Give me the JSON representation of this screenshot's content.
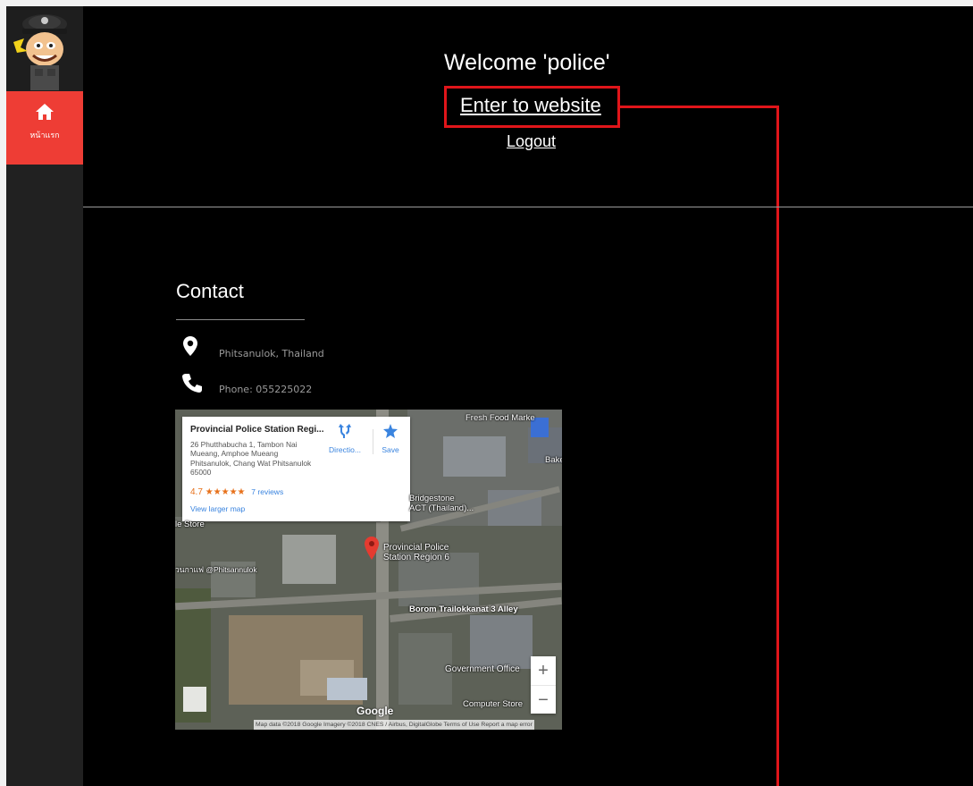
{
  "sidebar": {
    "logo": "police-mascot-logo",
    "home": {
      "icon": "home-icon",
      "label": "หน้าแรก"
    }
  },
  "header": {
    "welcome": "Welcome 'police'",
    "enter_link": "Enter to website",
    "logout_link": "Logout"
  },
  "contact": {
    "title": "Contact",
    "address": "Phitsanulok, Thailand",
    "phone": "Phone: 055225022"
  },
  "map": {
    "place_name": "Provincial Police Station Regi...",
    "place_address": "26 Phutthabucha 1, Tambon Nai Mueang, Amphoe Mueang Phitsanulok, Chang Wat Phitsanulok 65000",
    "rating": "4.7",
    "stars": "★★★★★",
    "reviews": "7 reviews",
    "directions_label": "Directio...",
    "save_label": "Save",
    "view_larger": "View larger map",
    "marker_label": "Provincial Police\nStation Region 6",
    "labels": {
      "fresh_food": "Fresh Food Marke",
      "bake": "Bake",
      "bridgestone": "Bridgestone\nACT (Thailand)...",
      "store": "le Store",
      "phitsanulok": "วนกาแฟ @Phitsannulok",
      "alley": "Borom Trailokkanat 3 Alley",
      "gov_office": "Government Office",
      "computer_store": "Computer Store"
    },
    "zoom_in": "+",
    "zoom_out": "−",
    "google": "Google",
    "attribution": "Map data ©2018 Google Imagery ©2018 CNES / Airbus, DigitalGlobe   Terms of Use   Report a map error"
  },
  "colors": {
    "sidebar_active": "#ee3d35",
    "highlight": "#e0151a",
    "link_blue": "#3a84df",
    "rating_orange": "#e7711b"
  }
}
